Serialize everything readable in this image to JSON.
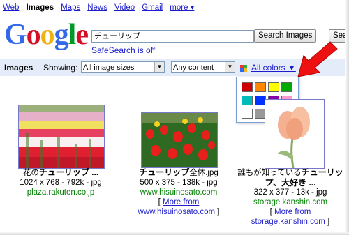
{
  "nav": {
    "items": [
      {
        "label": "Web",
        "active": false
      },
      {
        "label": "Images",
        "active": true
      },
      {
        "label": "Maps",
        "active": false
      },
      {
        "label": "News",
        "active": false
      },
      {
        "label": "Video",
        "active": false
      },
      {
        "label": "Gmail",
        "active": false
      },
      {
        "label": "more ▾",
        "active": false
      }
    ]
  },
  "logo": {
    "letters": [
      "G",
      "o",
      "o",
      "g",
      "l",
      "e"
    ],
    "colors": [
      "#3369e8",
      "#d50f25",
      "#eeb211",
      "#3369e8",
      "#009925",
      "#d50f25"
    ]
  },
  "search": {
    "value": "チューリップ",
    "search_images": "Search Images",
    "search_web": "Sear"
  },
  "safesearch": "SafeSearch is off",
  "toolbar": {
    "title": "Images",
    "showing": "Showing:",
    "size_select": "All image sizes",
    "content_select": "Any content",
    "colors_link": "All colors ▼"
  },
  "palette": {
    "colors": [
      "#cc0000",
      "#ff8800",
      "#ffff00",
      "#00aa00",
      "#00bbbb",
      "#0033ff",
      "#8800aa",
      "#ff99cc",
      "#ffffff",
      "#999999",
      "#000000",
      "#884411"
    ]
  },
  "accent": {
    "arrow": "#ee1111",
    "link": "#1c1ccc",
    "site": "#008000",
    "bar": "#e5ecf9"
  },
  "results": [
    {
      "title_prefix": "花の",
      "title_bold": "チューリップ ...",
      "meta": "1024 x 768 - 792k - jpg",
      "site": "plaza.rakuten.co.jp"
    },
    {
      "title_bold": "チューリップ",
      "title_suffix": "全体.jpg",
      "meta": "500 x 375 - 138k - jpg",
      "site": "www.hisuinosato.com",
      "more_open": "[ ",
      "more": "More from",
      "more_site": "www.hisuinosato.com",
      "more_close": " ]"
    },
    {
      "title_prefix": "誰もが知っている",
      "title_bold": "チューリッ",
      "title_line2": "プ、大好き ...",
      "meta": "322 x 377 - 13k - jpg",
      "site": "storage.kanshin.com",
      "more_open": "[ ",
      "more": "More from",
      "more_site": "storage.kanshin.com",
      "more_close": " ]"
    }
  ]
}
